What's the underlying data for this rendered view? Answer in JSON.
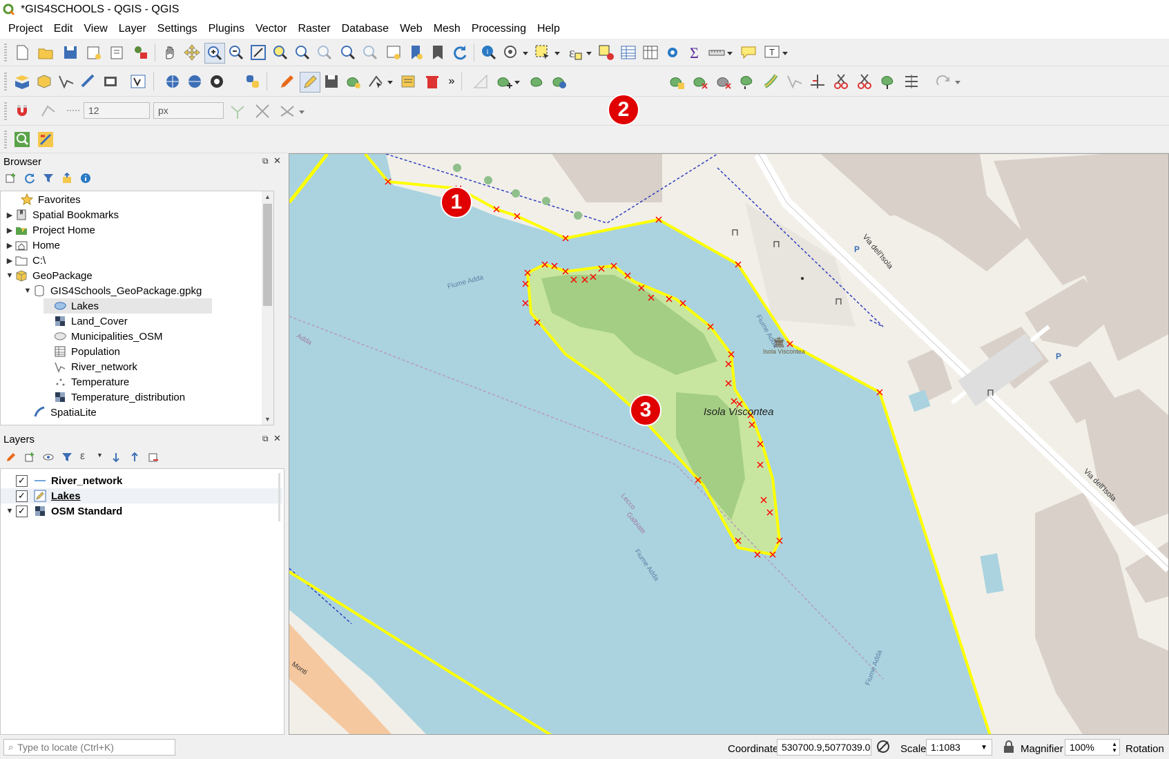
{
  "window": {
    "title": "*GIS4SCHOOLS - QGIS - QGIS"
  },
  "menu": [
    "Project",
    "Edit",
    "View",
    "Layer",
    "Settings",
    "Plugins",
    "Vector",
    "Raster",
    "Database",
    "Web",
    "Mesh",
    "Processing",
    "Help"
  ],
  "snapping": {
    "tolerance_value": "12",
    "unit": "px"
  },
  "browser": {
    "title": "Browser",
    "items": [
      {
        "label": "Favorites"
      },
      {
        "label": "Spatial Bookmarks"
      },
      {
        "label": "Project Home"
      },
      {
        "label": "Home"
      },
      {
        "label": "C:\\"
      },
      {
        "label": "GeoPackage"
      },
      {
        "label": "GIS4Schools_GeoPackage.gpkg"
      },
      {
        "label": "Lakes"
      },
      {
        "label": "Land_Cover"
      },
      {
        "label": "Municipalities_OSM"
      },
      {
        "label": "Population"
      },
      {
        "label": "River_network"
      },
      {
        "label": "Temperature"
      },
      {
        "label": "Temperature_distribution"
      },
      {
        "label": "SpatiaLite"
      }
    ]
  },
  "layers": {
    "title": "Layers",
    "items": [
      {
        "label": "River_network",
        "checked": "✓"
      },
      {
        "label": "Lakes",
        "checked": "✓"
      },
      {
        "label": "OSM Standard",
        "checked": "✓"
      }
    ]
  },
  "map": {
    "labels": {
      "island": "Isola Viscontea",
      "island_poi": "Isola Viscontea",
      "river1": "Fiume Adda",
      "river2": "Fiume Adda",
      "river3": "Fiume Adda",
      "river4": "Fiume Adda",
      "road1": "Via dell'Isola",
      "road2": "Via dell'Isola",
      "parking": "P",
      "lecco": "Lecco",
      "galbiate": "Galbiate",
      "adda": "Adda",
      "monti": "Monti"
    }
  },
  "annotations": {
    "one": "1",
    "two": "2",
    "three": "3"
  },
  "status": {
    "locate_placeholder": "Type to locate (Ctrl+K)",
    "coordinate_label": "Coordinate",
    "coordinate_value": "530700.9,5077039.0",
    "scale_label": "Scale",
    "scale_value": "1:1083",
    "magnifier_label": "Magnifier",
    "magnifier_value": "100%",
    "rotation_label": "Rotation"
  },
  "colors": {
    "water": "#aad3df",
    "island_light": "#c8e6a0",
    "island_dark": "#9cc97e",
    "edit_line": "#ffff00",
    "vertex": "#ff0000",
    "land": "#f2efe9",
    "building": "#d9d0c9"
  }
}
